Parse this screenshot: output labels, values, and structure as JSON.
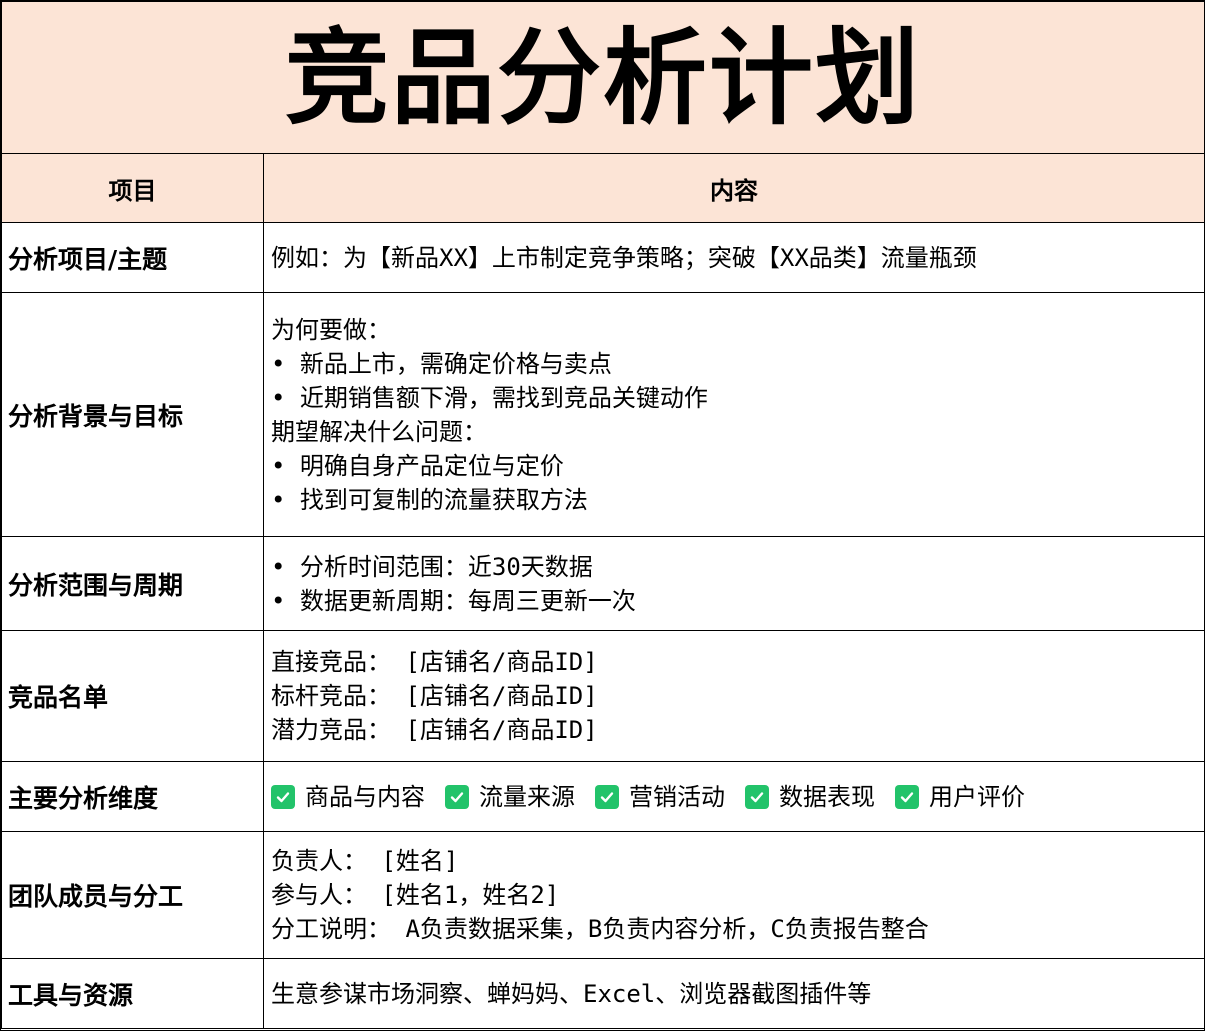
{
  "title": "竞品分析计划",
  "header": {
    "col1": "项目",
    "col2": "内容"
  },
  "rows": {
    "topic": {
      "label": "分析项目/主题",
      "lines": [
        "例如：为【新品XX】上市制定竞争策略；突破【XX品类】流量瓶颈"
      ]
    },
    "background": {
      "label": "分析背景与目标",
      "lines": [
        "为何要做：",
        "• 新品上市，需确定价格与卖点",
        "• 近期销售额下滑，需找到竞品关键动作",
        "期望解决什么问题：",
        "• 明确自身产品定位与定价",
        "• 找到可复制的流量获取方法"
      ]
    },
    "scope": {
      "label": "分析范围与周期",
      "lines": [
        "• 分析时间范围：近30天数据",
        "• 数据更新周期：每周三更新一次"
      ]
    },
    "competitors": {
      "label": "竞品名单",
      "lines": [
        "直接竞品： [店铺名/商品ID]",
        "标杆竞品： [店铺名/商品ID]",
        "潜力竞品： [店铺名/商品ID]"
      ]
    },
    "dimensions": {
      "label": "主要分析维度",
      "items": [
        "商品与内容",
        "流量来源",
        "营销活动",
        "数据表现",
        "用户评价"
      ],
      "check_color": "#22c36a"
    },
    "team": {
      "label": "团队成员与分工",
      "lines": [
        "负责人： [姓名]",
        "参与人： [姓名1，姓名2]",
        "分工说明： A负责数据采集，B负责内容分析，C负责报告整合"
      ]
    },
    "tools": {
      "label": "工具与资源",
      "lines": [
        "生意参谋市场洞察、蝉妈妈、Excel、浏览器截图插件等"
      ]
    }
  },
  "colors": {
    "header_bg": "#fce4d6",
    "border": "#000000"
  }
}
